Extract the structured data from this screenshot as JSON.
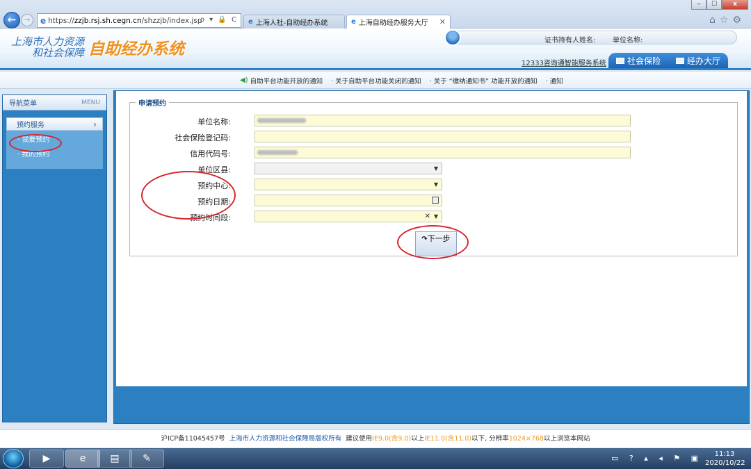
{
  "browser": {
    "url_prefix": "https://",
    "url_host": "zzjb.rsj.sh.cegn.cn",
    "url_path": "/shzzjb/index.jsp",
    "addr_tools": "ρ ▾ 🔒 C",
    "tabs": [
      {
        "label": "上海人社-自助经办系统",
        "active": false
      },
      {
        "label": "上海自助经办服务大厅",
        "active": true
      }
    ],
    "window_controls": {
      "minimize": "‒",
      "maximize": "☐",
      "close": "x"
    },
    "toolbar_icons": "⌂☆⚙"
  },
  "header": {
    "logo_line1": "上海市人力资源",
    "logo_line2": "和社会保障",
    "logo_title": "自助经办系统",
    "cert_holder_label": "证书持有人姓名:",
    "unit_name_label": "单位名称:",
    "hotline_link": "12333咨询通智能服务系统",
    "nav_tabs": [
      "社会保险",
      "经办大厅"
    ]
  },
  "notices": [
    "自助平台功能开放的通知",
    "· 关于自助平台功能关闭的通知",
    "· 关于 “缴纳通知书” 功能开放的通知",
    "· 通知"
  ],
  "sidebar": {
    "title": "导航菜单",
    "title_en": "MENU",
    "group": "预约服务",
    "items": [
      {
        "label": "· 我要预约",
        "active": true
      },
      {
        "label": "· 我的预约",
        "active": false
      }
    ]
  },
  "form": {
    "legend": "申请预约",
    "fields": [
      {
        "label": "单位名称:",
        "value": ""
      },
      {
        "label": "社会保险登记码:",
        "value": ""
      },
      {
        "label": "信用代码号:",
        "value": ""
      },
      {
        "label": "单位区县:",
        "value": ""
      },
      {
        "label": "预约中心:",
        "value": ""
      },
      {
        "label": "预约日期:",
        "value": ""
      },
      {
        "label": "预约时间段:",
        "value": ""
      }
    ],
    "next_button_arrow": "↷",
    "next_button_label": "下一步"
  },
  "footer": {
    "icp": "沪ICP备11045457号",
    "copyright": "上海市人力资源和社会保障局版权所有",
    "suggest_prefix": "建议使用",
    "ie_range_1": "IE9.0(含9.0)",
    "ie_mid": "以上",
    "ie_range_2": "IE11.0(含11.0)",
    "ie_suffix": "以下, 分辨率",
    "resolution": "1024×768",
    "ie_end": "以上浏览本网站"
  },
  "taskbar": {
    "time": "11:13",
    "date": "2020/10/22"
  },
  "colors": {
    "accent": "#2c7fc1",
    "highlight_circle": "#d8262c",
    "input_bg": "#fdfbd6",
    "logo_orange": "#f0921e"
  }
}
